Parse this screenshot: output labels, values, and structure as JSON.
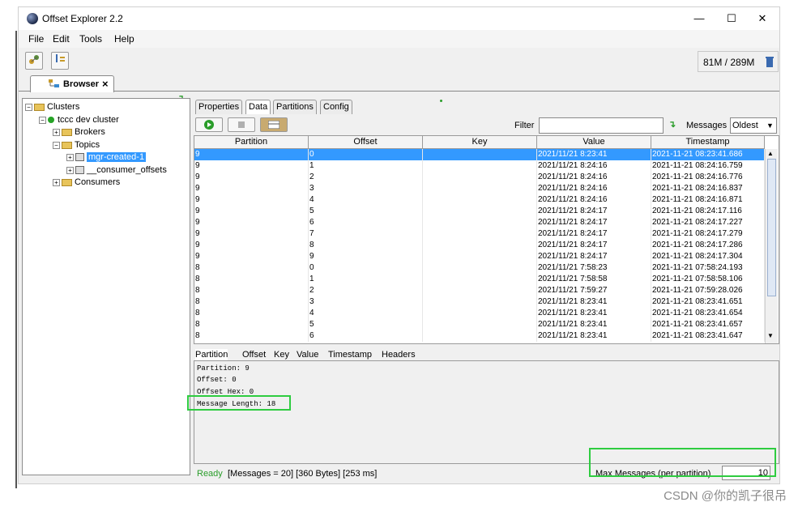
{
  "window": {
    "title": "Offset Explorer  2.2",
    "controls": [
      "—",
      "☐",
      "✕"
    ]
  },
  "menu": [
    "File",
    "Edit",
    "Tools",
    "Help"
  ],
  "toolbar": {
    "memory": "81M / 289M"
  },
  "browser_tab": {
    "label": "Browser",
    "close": "×"
  },
  "tree": {
    "root": "Clusters",
    "cluster": "tccc dev cluster",
    "brokers": "Brokers",
    "topics": "Topics",
    "topic_selected": "mgr-created-1",
    "topic_other": "__consumer_offsets",
    "consumers": "Consumers"
  },
  "tabs": [
    "Properties",
    "Data",
    "Partitions",
    "Config"
  ],
  "controls": {
    "filter_label": "Filter",
    "filter_value": "",
    "messages_label": "Messages",
    "messages_value": "Oldest"
  },
  "columns": [
    "Partition",
    "Offset",
    "Key",
    "Value",
    "Timestamp"
  ],
  "rows": [
    {
      "partition": "9",
      "offset": "0",
      "key": "",
      "value": "2021/11/21 8:23:41",
      "timestamp": "2021-11-21 08:23:41.686"
    },
    {
      "partition": "9",
      "offset": "1",
      "key": "",
      "value": "2021/11/21 8:24:16",
      "timestamp": "2021-11-21 08:24:16.759"
    },
    {
      "partition": "9",
      "offset": "2",
      "key": "",
      "value": "2021/11/21 8:24:16",
      "timestamp": "2021-11-21 08:24:16.776"
    },
    {
      "partition": "9",
      "offset": "3",
      "key": "",
      "value": "2021/11/21 8:24:16",
      "timestamp": "2021-11-21 08:24:16.837"
    },
    {
      "partition": "9",
      "offset": "4",
      "key": "",
      "value": "2021/11/21 8:24:16",
      "timestamp": "2021-11-21 08:24:16.871"
    },
    {
      "partition": "9",
      "offset": "5",
      "key": "",
      "value": "2021/11/21 8:24:17",
      "timestamp": "2021-11-21 08:24:17.116"
    },
    {
      "partition": "9",
      "offset": "6",
      "key": "",
      "value": "2021/11/21 8:24:17",
      "timestamp": "2021-11-21 08:24:17.227"
    },
    {
      "partition": "9",
      "offset": "7",
      "key": "",
      "value": "2021/11/21 8:24:17",
      "timestamp": "2021-11-21 08:24:17.279"
    },
    {
      "partition": "9",
      "offset": "8",
      "key": "",
      "value": "2021/11/21 8:24:17",
      "timestamp": "2021-11-21 08:24:17.286"
    },
    {
      "partition": "9",
      "offset": "9",
      "key": "",
      "value": "2021/11/21 8:24:17",
      "timestamp": "2021-11-21 08:24:17.304"
    },
    {
      "partition": "8",
      "offset": "0",
      "key": "",
      "value": "2021/11/21 7:58:23",
      "timestamp": "2021-11-21 07:58:24.193"
    },
    {
      "partition": "8",
      "offset": "1",
      "key": "",
      "value": "2021/11/21 7:58:58",
      "timestamp": "2021-11-21 07:58:58.106"
    },
    {
      "partition": "8",
      "offset": "2",
      "key": "",
      "value": "2021/11/21 7:59:27",
      "timestamp": "2021-11-21 07:59:28.026"
    },
    {
      "partition": "8",
      "offset": "3",
      "key": "",
      "value": "2021/11/21 8:23:41",
      "timestamp": "2021-11-21 08:23:41.651"
    },
    {
      "partition": "8",
      "offset": "4",
      "key": "",
      "value": "2021/11/21 8:23:41",
      "timestamp": "2021-11-21 08:23:41.654"
    },
    {
      "partition": "8",
      "offset": "5",
      "key": "",
      "value": "2021/11/21 8:23:41",
      "timestamp": "2021-11-21 08:23:41.657"
    },
    {
      "partition": "8",
      "offset": "6",
      "key": "",
      "value": "2021/11/21 8:23:41",
      "timestamp": "2021-11-21 08:23:41.647"
    }
  ],
  "detail_tabs": [
    "Partition",
    "Offset",
    "Key",
    "Value",
    "Timestamp",
    "Headers"
  ],
  "detail": {
    "partition": "Partition: 9",
    "offset": "Offset: 0",
    "offset_hex": "Offset Hex: 0",
    "message_length": "Message Length: 18"
  },
  "status": {
    "ready": "Ready",
    "info": "[Messages = 20]  [360 Bytes]  [253 ms]",
    "max_label": "Max Messages (per partition)",
    "max_value": "10"
  },
  "watermark": "CSDN @你的凯子很吊",
  "colors": {
    "highlight": "#2ecc40",
    "selection": "#3399ff",
    "ready": "#2a9d2a"
  }
}
